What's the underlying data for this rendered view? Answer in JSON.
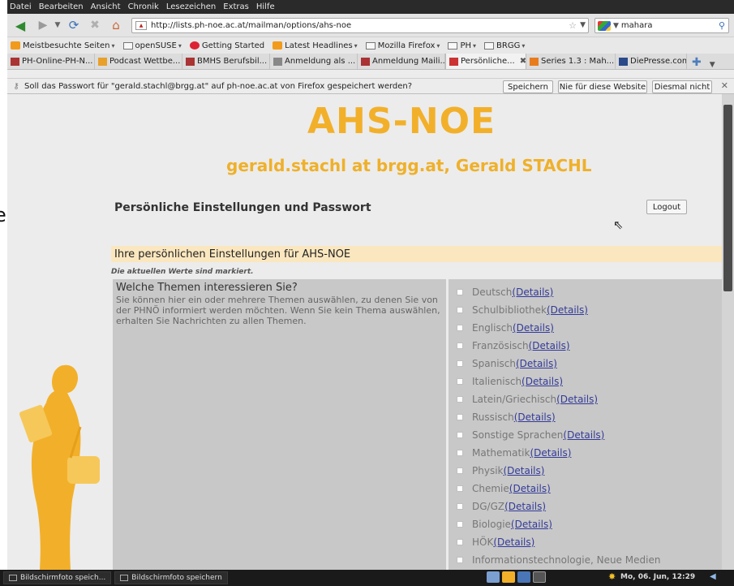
{
  "behind": {
    "char": "e"
  },
  "menubar": [
    "Datei",
    "Bearbeiten",
    "Ansicht",
    "Chronik",
    "Lesezeichen",
    "Extras",
    "Hilfe"
  ],
  "navbar": {
    "url": "http://lists.ph-noe.ac.at/mailman/options/ahs-noe",
    "search_value": "mahara"
  },
  "bookmarks": [
    {
      "label": "Meistbesuchte Seiten",
      "icon": "rss-icon"
    },
    {
      "label": "openSUSE",
      "icon": "folder-icon"
    },
    {
      "label": "Getting Started",
      "icon": "firefox-icon"
    },
    {
      "label": "Latest Headlines",
      "icon": "rss-icon"
    },
    {
      "label": "Mozilla Firefox",
      "icon": "folder-icon"
    },
    {
      "label": "PH",
      "icon": "folder-icon"
    },
    {
      "label": "BRGG",
      "icon": "folder-icon"
    }
  ],
  "tabs": [
    {
      "label": "PH-Online-PH-N...",
      "color": "#a33"
    },
    {
      "label": "Podcast Wettbe...",
      "color": "#e8a02a"
    },
    {
      "label": "BMHS Berufsbil...",
      "color": "#a33"
    },
    {
      "label": "Anmeldung als ...",
      "color": "#888"
    },
    {
      "label": "Anmeldung Maili...",
      "color": "#a33"
    },
    {
      "label": "Persönliche...",
      "color": "#c33"
    },
    {
      "label": "Series 1.3 : Mah...",
      "color": "#e87c1c"
    },
    {
      "label": "DiePresse.com",
      "color": "#2a4a8a"
    }
  ],
  "password_bar": {
    "message": "Soll das Passwort für \"gerald.stachl@brgg.at\" auf ph-noe.ac.at von Firefox gespeichert werden?",
    "save": "Speichern",
    "never": "Nie für diese Website",
    "not_now": "Diesmal nicht"
  },
  "page": {
    "list_name": "AHS-NOE",
    "user": "gerald.stachl at brgg.at, Gerald STACHL",
    "section": "Persönliche Einstellungen und Passwort",
    "logout": "Logout",
    "settings_header": "Ihre persönlichen Einstellungen für AHS-NOE",
    "current_note": "Die aktuellen Werte sind markiert.",
    "question": "Welche Themen interessieren Sie?",
    "help": "Sie können hier ein oder mehrere Themen auswählen, zu denen Sie von der PHNÖ informiert werden möchten. Wenn Sie kein Thema auswählen, erhalten Sie Nachrichten zu allen Themen.",
    "details_label": " (Details)",
    "topics": [
      "Deutsch",
      "Schulbibliothek",
      "Englisch",
      "Französisch",
      "Spanisch",
      "Italienisch",
      "Latein/Griechisch",
      "Russisch",
      "Sonstige Sprachen",
      "Mathematik",
      "Physik",
      "Chemie",
      "DG/GZ",
      "Biologie",
      "HÖK",
      "Informationstechnologie, Neue Medien"
    ]
  },
  "taskbar": {
    "tasks": [
      "Bildschirmfoto speich...",
      "Bildschirmfoto speichern"
    ],
    "clock": "Mo, 06. Jun, 12:29"
  },
  "colors": {
    "accent": "#f2b02a",
    "settings_bg": "#fbe7bf",
    "panel_bg": "#c8c8c8",
    "link": "#333a99"
  }
}
